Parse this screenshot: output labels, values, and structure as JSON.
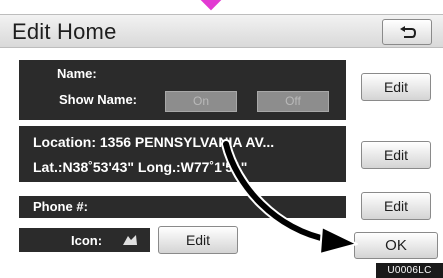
{
  "header": {
    "title": "Edit Home"
  },
  "name_section": {
    "name_label": "Name:",
    "show_name_label": "Show Name:",
    "on_label": "On",
    "off_label": "Off",
    "edit_label": "Edit"
  },
  "location_section": {
    "address": "Location: 1356 PENNSYLVANIA AV...",
    "coords": "Lat.:N38˚53'43\"  Long.:W77˚1'51\"",
    "edit_label": "Edit"
  },
  "phone_section": {
    "label": "Phone #:",
    "edit_label": "Edit"
  },
  "icon_section": {
    "label": "Icon:",
    "edit_label": "Edit",
    "icon_name": "home-marker-icon"
  },
  "footer": {
    "ok_label": "OK",
    "code": "U0006LC"
  },
  "colors": {
    "panel": "#2b2b2b",
    "pointer": "#e23ad2",
    "arrow": "#000000"
  }
}
